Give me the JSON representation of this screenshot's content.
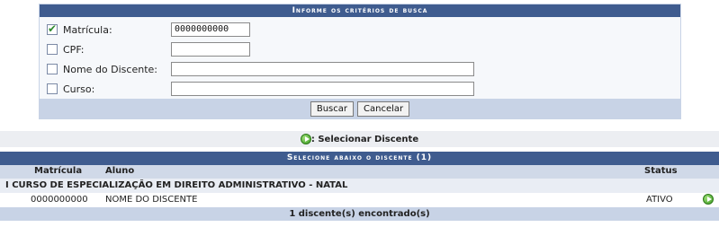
{
  "search": {
    "caption": "Informe os critérios de busca",
    "fields": [
      {
        "label": "Matrícula:",
        "value": "0000000000",
        "checked": true
      },
      {
        "label": "CPF:",
        "value": "",
        "checked": false
      },
      {
        "label": "Nome do Discente:",
        "value": "",
        "checked": false
      },
      {
        "label": "Curso:",
        "value": "",
        "checked": false
      }
    ],
    "buttons": {
      "search": "Buscar",
      "cancel": "Cancelar"
    }
  },
  "legend": {
    "text": ": Selecionar Discente",
    "icon": "green-arrow-icon"
  },
  "results": {
    "caption": "Selecione abaixo o discente (1)",
    "headers": {
      "matricula": "Matrícula",
      "aluno": "Aluno",
      "status": "Status"
    },
    "group": "I CURSO DE ESPECIALIZAÇÃO EM DIREITO ADMINISTRATIVO - NATAL",
    "rows": [
      {
        "matricula": "0000000000",
        "aluno": "NOME DO DISCENTE",
        "status": "ATIVO"
      }
    ],
    "footer": "1 discente(s) encontrado(s)"
  }
}
